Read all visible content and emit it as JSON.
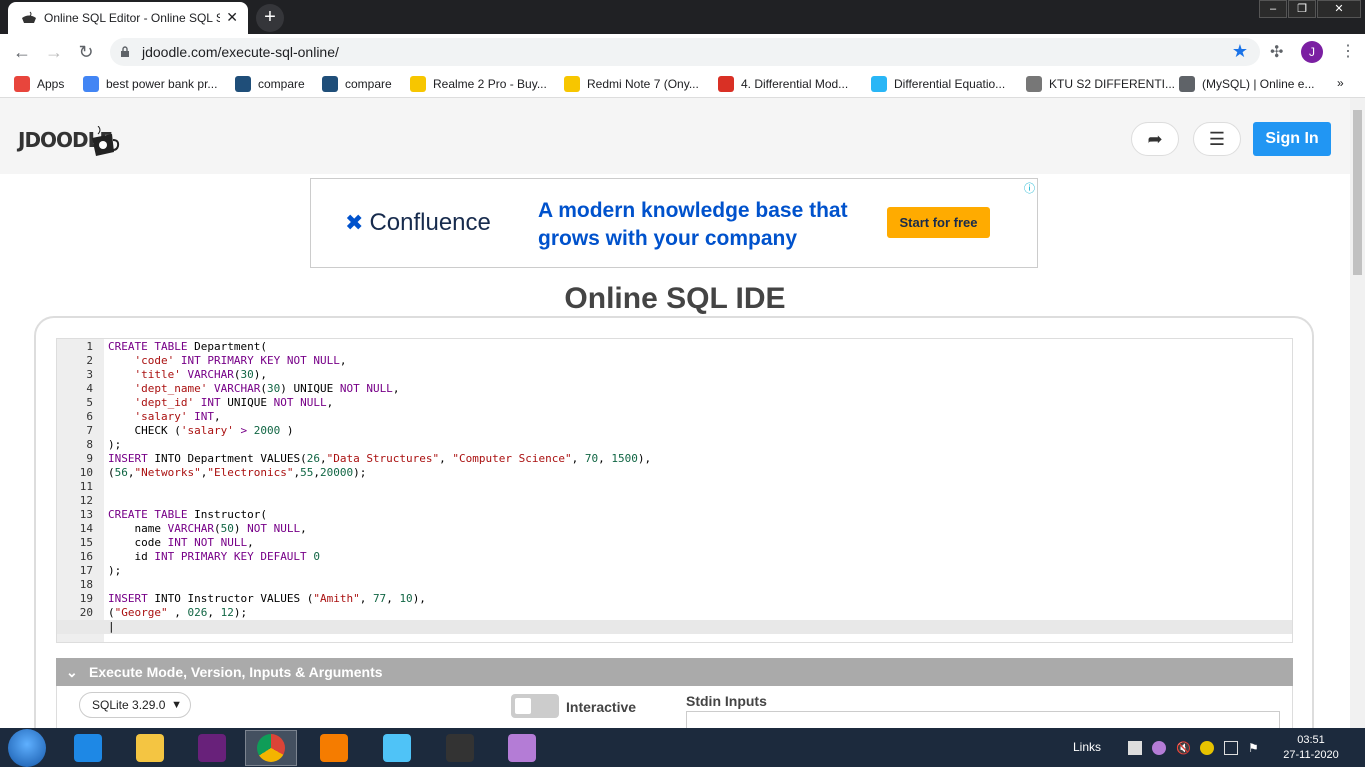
{
  "browser": {
    "tab_title": "Online SQL Editor - Online SQL S",
    "tab_close": "✕",
    "new_tab": "+",
    "url": "jdoodle.com/execute-sql-online/",
    "avatar_letter": "J",
    "window_controls": [
      "–",
      "❐",
      "✕"
    ]
  },
  "bookmarks": [
    {
      "label": "Apps",
      "icon": "apps-grid-icon",
      "color": "#e8453c"
    },
    {
      "label": "best power bank pr...",
      "icon": "google-icon",
      "color": "#4285f4"
    },
    {
      "label": "compare",
      "icon": "gn-icon",
      "color": "#1f4e79"
    },
    {
      "label": "compare",
      "icon": "gn-icon",
      "color": "#1f4e79"
    },
    {
      "label": "Realme 2 Pro - Buy...",
      "icon": "flipkart-icon",
      "color": "#f7c600"
    },
    {
      "label": "Redmi Note 7 (Ony...",
      "icon": "flipkart-icon",
      "color": "#f7c600"
    },
    {
      "label": "4. Differential Mod...",
      "icon": "pdf-icon",
      "color": "#d93025"
    },
    {
      "label": "Differential Equatio...",
      "icon": "site-icon",
      "color": "#29b6f6"
    },
    {
      "label": "KTU S2 DIFFERENTI...",
      "icon": "globe-icon",
      "color": "#777777"
    },
    {
      "label": "(MySQL) | Online e...",
      "icon": "jdoodle-icon",
      "color": "#5f6368"
    }
  ],
  "bookmarks_overflow": "»",
  "header": {
    "logo_text": "JDOODLE",
    "share_icon": "share-icon",
    "menu_icon": "hamburger-icon",
    "signin_label": "Sign In"
  },
  "ad": {
    "brand": "Confluence",
    "headline": "A modern knowledge base that grows with your company",
    "cta": "Start for free",
    "info": "ⓘ"
  },
  "page_title": "Online SQL IDE",
  "editor": {
    "lines": [
      [
        [
          "kw",
          "CREATE TABLE"
        ],
        [
          "op",
          " Department("
        ]
      ],
      [
        [
          "op",
          "    "
        ],
        [
          "str",
          "'code'"
        ],
        [
          "op",
          " "
        ],
        [
          "kw",
          "INT PRIMARY KEY NOT NULL"
        ],
        [
          "op",
          ","
        ]
      ],
      [
        [
          "op",
          "    "
        ],
        [
          "str",
          "'title'"
        ],
        [
          "op",
          " "
        ],
        [
          "kw",
          "VARCHAR"
        ],
        [
          "op",
          "("
        ],
        [
          "num",
          "30"
        ],
        [
          "op",
          "),"
        ]
      ],
      [
        [
          "op",
          "    "
        ],
        [
          "str",
          "'dept_name'"
        ],
        [
          "op",
          " "
        ],
        [
          "kw",
          "VARCHAR"
        ],
        [
          "op",
          "("
        ],
        [
          "num",
          "30"
        ],
        [
          "op",
          ") UNIQUE "
        ],
        [
          "kw",
          "NOT NULL"
        ],
        [
          "op",
          ","
        ]
      ],
      [
        [
          "op",
          "    "
        ],
        [
          "str",
          "'dept_id'"
        ],
        [
          "op",
          " "
        ],
        [
          "kw",
          "INT"
        ],
        [
          "op",
          " UNIQUE "
        ],
        [
          "kw",
          "NOT NULL"
        ],
        [
          "op",
          ","
        ]
      ],
      [
        [
          "op",
          "    "
        ],
        [
          "str",
          "'salary'"
        ],
        [
          "op",
          " "
        ],
        [
          "kw",
          "INT"
        ],
        [
          "op",
          ","
        ]
      ],
      [
        [
          "op",
          "    CHECK ("
        ],
        [
          "str",
          "'salary'"
        ],
        [
          "op",
          " "
        ],
        [
          "kw",
          ">"
        ],
        [
          "op",
          " "
        ],
        [
          "num",
          "2000"
        ],
        [
          "op",
          " )"
        ]
      ],
      [
        [
          "op",
          ");"
        ]
      ],
      [
        [
          "kw",
          "INSERT"
        ],
        [
          "op",
          " INTO Department VALUES("
        ],
        [
          "num",
          "26"
        ],
        [
          "op",
          ","
        ],
        [
          "str",
          "\"Data Structures\""
        ],
        [
          "op",
          ", "
        ],
        [
          "str",
          "\"Computer Science\""
        ],
        [
          "op",
          ", "
        ],
        [
          "num",
          "70"
        ],
        [
          "op",
          ", "
        ],
        [
          "num",
          "1500"
        ],
        [
          "op",
          "),"
        ]
      ],
      [
        [
          "op",
          "("
        ],
        [
          "num",
          "56"
        ],
        [
          "op",
          ","
        ],
        [
          "str",
          "\"Networks\""
        ],
        [
          "op",
          ","
        ],
        [
          "str",
          "\"Electronics\""
        ],
        [
          "op",
          ","
        ],
        [
          "num",
          "55"
        ],
        [
          "op",
          ","
        ],
        [
          "num",
          "20000"
        ],
        [
          "op",
          ");"
        ]
      ],
      [],
      [],
      [
        [
          "kw",
          "CREATE TABLE"
        ],
        [
          "op",
          " Instructor("
        ]
      ],
      [
        [
          "op",
          "    name "
        ],
        [
          "kw",
          "VARCHAR"
        ],
        [
          "op",
          "("
        ],
        [
          "num",
          "50"
        ],
        [
          "op",
          ") "
        ],
        [
          "kw",
          "NOT NULL"
        ],
        [
          "op",
          ","
        ]
      ],
      [
        [
          "op",
          "    code "
        ],
        [
          "kw",
          "INT NOT NULL"
        ],
        [
          "op",
          ","
        ]
      ],
      [
        [
          "op",
          "    id "
        ],
        [
          "kw",
          "INT PRIMARY KEY DEFAULT"
        ],
        [
          "op",
          " "
        ],
        [
          "num",
          "0"
        ]
      ],
      [
        [
          "op",
          ");"
        ]
      ],
      [],
      [
        [
          "kw",
          "INSERT"
        ],
        [
          "op",
          " INTO Instructor VALUES ("
        ],
        [
          "str",
          "\"Amith\""
        ],
        [
          "op",
          ", "
        ],
        [
          "num",
          "77"
        ],
        [
          "op",
          ", "
        ],
        [
          "num",
          "10"
        ],
        [
          "op",
          "),"
        ]
      ],
      [
        [
          "op",
          "("
        ],
        [
          "str",
          "\"George\""
        ],
        [
          "op",
          " , "
        ],
        [
          "num",
          "026"
        ],
        [
          "op",
          ", "
        ],
        [
          "num",
          "12"
        ],
        [
          "op",
          ");"
        ]
      ],
      [
        [
          "op",
          "|"
        ]
      ]
    ],
    "active_line": 21
  },
  "execute": {
    "section_title": "Execute Mode, Version, Inputs & Arguments",
    "version_selected": "SQLite 3.29.0",
    "interactive_label": "Interactive",
    "interactive_on": false,
    "stdin_label": "Stdin Inputs"
  },
  "taskbar": {
    "apps": [
      "internet-explorer-icon",
      "file-explorer-icon",
      "visual-studio-icon",
      "chrome-icon",
      "media-player-icon",
      "control-panel-icon",
      "sublime-text-icon",
      "feather-app-icon"
    ],
    "links_label": "Links",
    "time": "03:51",
    "date": "27-11-2020"
  }
}
